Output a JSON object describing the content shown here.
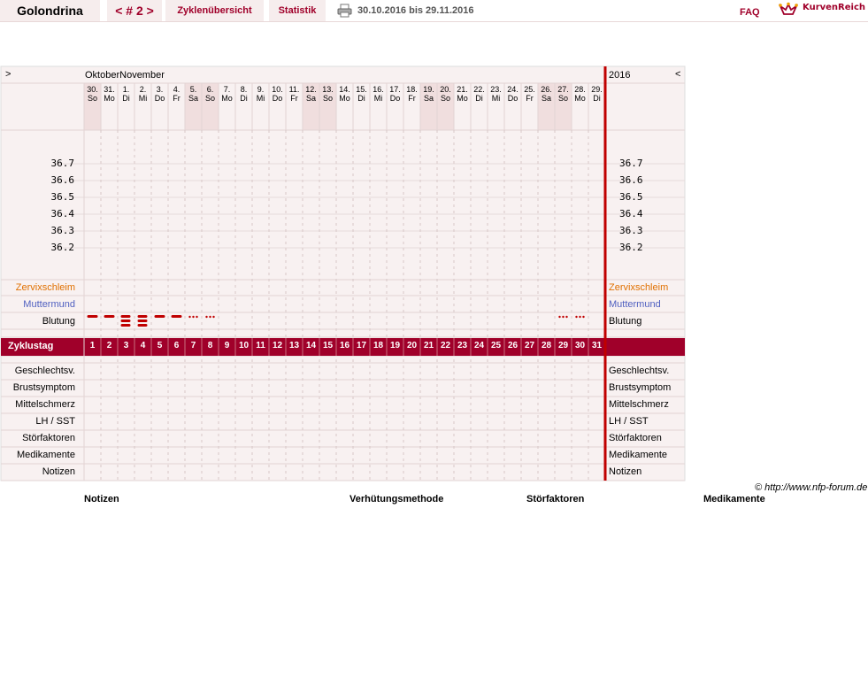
{
  "header": {
    "app_title": "Golondrina",
    "cycle_nav": "< # 2 >",
    "zyklen_label": "Zyklenübersicht",
    "statistik_label": "Statistik",
    "date_range": "30.10.2016 bis 29.11.2016",
    "faq_label": "FAQ",
    "logo_text": "KurvenReich",
    "print_icon": "printer-icon"
  },
  "chart": {
    "nav_prev": ">",
    "nav_next": "<",
    "months": "OktoberNovember",
    "year": "2016",
    "days": [
      {
        "d": "30.",
        "w": "So",
        "we": true
      },
      {
        "d": "31.",
        "w": "Mo",
        "we": false
      },
      {
        "d": "1.",
        "w": "Di",
        "we": false
      },
      {
        "d": "2.",
        "w": "Mi",
        "we": false
      },
      {
        "d": "3.",
        "w": "Do",
        "we": false
      },
      {
        "d": "4.",
        "w": "Fr",
        "we": false
      },
      {
        "d": "5.",
        "w": "Sa",
        "we": true
      },
      {
        "d": "6.",
        "w": "So",
        "we": true
      },
      {
        "d": "7.",
        "w": "Mo",
        "we": false
      },
      {
        "d": "8.",
        "w": "Di",
        "we": false
      },
      {
        "d": "9.",
        "w": "Mi",
        "we": false
      },
      {
        "d": "10.",
        "w": "Do",
        "we": false
      },
      {
        "d": "11.",
        "w": "Fr",
        "we": false
      },
      {
        "d": "12.",
        "w": "Sa",
        "we": true
      },
      {
        "d": "13.",
        "w": "So",
        "we": true
      },
      {
        "d": "14.",
        "w": "Mo",
        "we": false
      },
      {
        "d": "15.",
        "w": "Di",
        "we": false
      },
      {
        "d": "16.",
        "w": "Mi",
        "we": false
      },
      {
        "d": "17.",
        "w": "Do",
        "we": false
      },
      {
        "d": "18.",
        "w": "Fr",
        "we": false
      },
      {
        "d": "19.",
        "w": "Sa",
        "we": true
      },
      {
        "d": "20.",
        "w": "So",
        "we": true
      },
      {
        "d": "21.",
        "w": "Mo",
        "we": false
      },
      {
        "d": "22.",
        "w": "Di",
        "we": false
      },
      {
        "d": "23.",
        "w": "Mi",
        "we": false
      },
      {
        "d": "24.",
        "w": "Do",
        "we": false
      },
      {
        "d": "25.",
        "w": "Fr",
        "we": false
      },
      {
        "d": "26.",
        "w": "Sa",
        "we": true
      },
      {
        "d": "27.",
        "w": "So",
        "we": true
      },
      {
        "d": "28.",
        "w": "Mo",
        "we": false
      },
      {
        "d": "29.",
        "w": "Di",
        "we": false
      }
    ],
    "temperature_ticks": [
      "36.7",
      "36.6",
      "36.5",
      "36.4",
      "36.3",
      "36.2"
    ],
    "zervix_label": "Zervixschleim",
    "muttermund_label": "Muttermund",
    "blutung_label": "Blutung",
    "zyklustag_label": "Zyklustag",
    "cycle_days": [
      "1",
      "2",
      "3",
      "4",
      "5",
      "6",
      "7",
      "8",
      "9",
      "10",
      "11",
      "12",
      "13",
      "14",
      "15",
      "16",
      "17",
      "18",
      "19",
      "20",
      "21",
      "22",
      "23",
      "24",
      "25",
      "26",
      "27",
      "28",
      "29",
      "30",
      "31"
    ],
    "bleeding": [
      "strong",
      "strong",
      "very-strong",
      "very-strong",
      "strong",
      "strong",
      "spotting",
      "spotting",
      "",
      "",
      "",
      "",
      "",
      "",
      "",
      "",
      "",
      "",
      "",
      "",
      "",
      "",
      "",
      "",
      "",
      "",
      "",
      "",
      "spotting",
      "spotting",
      ""
    ],
    "bottom_rows": [
      "Geschlechtsv.",
      "Brustsymptom",
      "Mittelschmerz",
      "LH / SST",
      "Störfaktoren",
      "Medikamente",
      "Notizen"
    ],
    "colors": {
      "accent": "#a0002a",
      "zervix": "#e07000",
      "muttermund": "#5060c0",
      "grid": "#e8dcdc",
      "bg": "#f8f1f1",
      "weekend": "#f0dede"
    }
  },
  "footer": {
    "credit": "© http://www.nfp-forum.de",
    "notizen": "Notizen",
    "verhuetung": "Verhütungsmethode",
    "stoerfaktoren": "Störfaktoren",
    "medikamente": "Medikamente"
  }
}
